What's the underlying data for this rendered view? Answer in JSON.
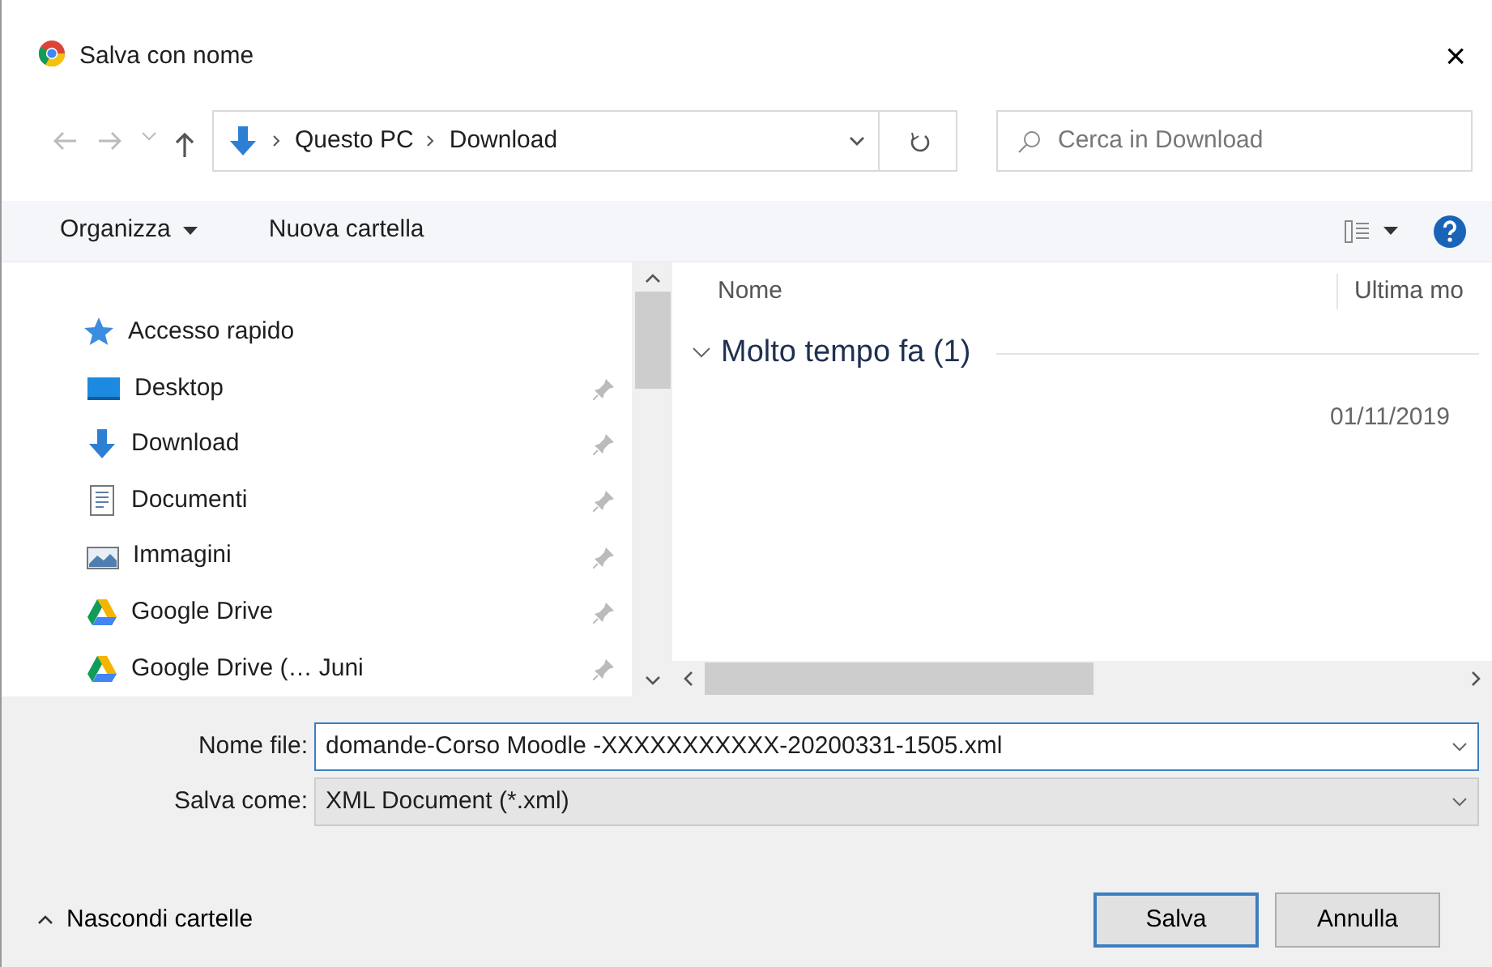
{
  "window": {
    "title": "Salva con nome",
    "close": "×"
  },
  "address_bar": {
    "path": [
      "Questo PC",
      "Download"
    ],
    "search_placeholder": "Cerca in Download"
  },
  "toolbar": {
    "organize": "Organizza",
    "new_folder": "Nuova cartella"
  },
  "sidebar": {
    "header": "Accesso rapido",
    "items": [
      {
        "label": "Desktop",
        "kind": "desktop",
        "pinned": true
      },
      {
        "label": "Download",
        "kind": "download",
        "pinned": true
      },
      {
        "label": "Documenti",
        "kind": "document",
        "pinned": true
      },
      {
        "label": "Immagini",
        "kind": "image",
        "pinned": true
      },
      {
        "label": "Google Drive",
        "kind": "drive",
        "pinned": true
      },
      {
        "label": "Google Drive (… Juni",
        "kind": "drive",
        "pinned": true
      }
    ]
  },
  "file_list": {
    "columns": [
      "Nome",
      "Ultima mo"
    ],
    "groups": [
      {
        "label": "Molto tempo fa (1)",
        "expanded": true,
        "rows": [
          {
            "name": "",
            "date": "01/11/2019"
          }
        ]
      }
    ]
  },
  "form": {
    "file_name_label": "Nome file:",
    "file_name": "domande-Corso Moodle -XXXXXXXXXXX-20200331-1505.xml",
    "type_label": "Salva come:",
    "type": "XML Document (*.xml)"
  },
  "footer": {
    "toggle": "Nascondi cartelle",
    "buttons": [
      "Salva",
      "Annulla"
    ]
  }
}
